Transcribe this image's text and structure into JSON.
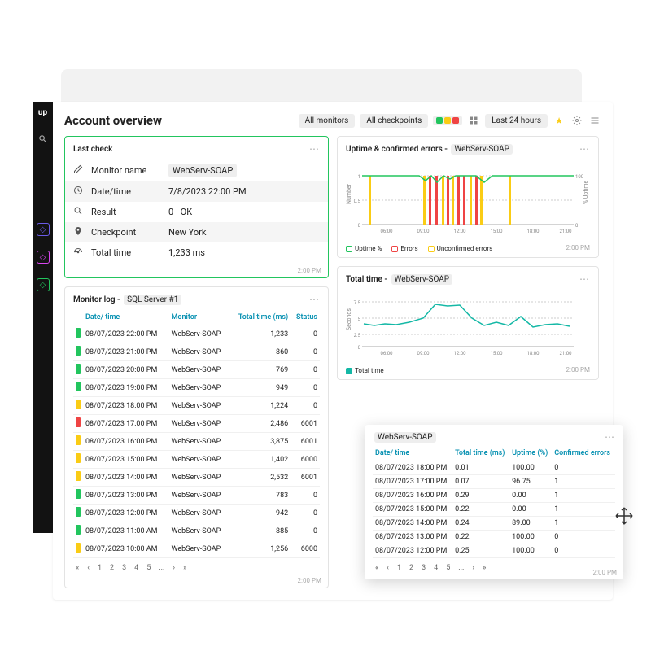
{
  "header": {
    "title": "Account overview",
    "all_monitors": "All monitors",
    "all_checkpoints": "All checkpoints",
    "time_range": "Last 24 hours"
  },
  "last_check": {
    "title": "Last check",
    "rows": [
      {
        "icon": "pencil",
        "label": "Monitor name",
        "value": "WebServ-SOAP",
        "boxed": true
      },
      {
        "icon": "clock",
        "label": "Date/time",
        "value": "7/8/2023 22:00 PM",
        "alt": true
      },
      {
        "icon": "search",
        "label": "Result",
        "value": "0 - OK"
      },
      {
        "icon": "pin",
        "label": "Checkpoint",
        "value": "New York",
        "alt": true
      },
      {
        "icon": "gauge",
        "label": "Total time",
        "value": "1,233 ms"
      }
    ],
    "ts": "2:00 PM"
  },
  "monitor_log": {
    "title": "Monitor log -",
    "chip": "SQL Server #1",
    "headers": [
      "Date/ time",
      "Monitor",
      "Total time (ms)",
      "Status"
    ],
    "rows": [
      {
        "s": "g",
        "dt": "08/07/2023 22:00 PM",
        "m": "WebServ-SOAP",
        "t": "1,233",
        "st": "0"
      },
      {
        "s": "g",
        "dt": "08/07/2023 21:00 PM",
        "m": "WebServ-SOAP",
        "t": "860",
        "st": "0"
      },
      {
        "s": "g",
        "dt": "08/07/2023 20:00 PM",
        "m": "WebServ-SOAP",
        "t": "769",
        "st": "0"
      },
      {
        "s": "g",
        "dt": "08/07/2023 19:00 PM",
        "m": "WebServ-SOAP",
        "t": "949",
        "st": "0"
      },
      {
        "s": "y",
        "dt": "08/07/2023 18:00 PM",
        "m": "WebServ-SOAP",
        "t": "1,224",
        "st": "0"
      },
      {
        "s": "r",
        "dt": "08/07/2023 17:00 PM",
        "m": "WebServ-SOAP",
        "t": "2,486",
        "st": "6001"
      },
      {
        "s": "y",
        "dt": "08/07/2023 16:00 PM",
        "m": "WebServ-SOAP",
        "t": "3,875",
        "st": "6001"
      },
      {
        "s": "y",
        "dt": "08/07/2023 15:00 PM",
        "m": "WebServ-SOAP",
        "t": "1,402",
        "st": "6000"
      },
      {
        "s": "y",
        "dt": "08/07/2023 14:00 PM",
        "m": "WebServ-SOAP",
        "t": "2,532",
        "st": "6001"
      },
      {
        "s": "g",
        "dt": "08/07/2023 13:00 PM",
        "m": "WebServ-SOAP",
        "t": "783",
        "st": "0"
      },
      {
        "s": "g",
        "dt": "08/07/2023 12:00 PM",
        "m": "WebServ-SOAP",
        "t": "942",
        "st": "0"
      },
      {
        "s": "g",
        "dt": "08/07/2023 11:00 AM",
        "m": "WebServ-SOAP",
        "t": "885",
        "st": "0"
      },
      {
        "s": "y",
        "dt": "08/07/2023 10:00 AM",
        "m": "WebServ-SOAP",
        "t": "1,256",
        "st": "6000"
      }
    ],
    "pages": [
      "1",
      "2",
      "3",
      "4",
      "5",
      "..."
    ],
    "ts": "2:00 PM"
  },
  "uptime_chart": {
    "title": "Uptime & confirmed errors -",
    "chip": "WebServ-SOAP",
    "ylabel_left": "Number",
    "ylabel_right": "% Uptime",
    "legend": [
      "Uptime %",
      "Errors",
      "Unconfirmed errors"
    ],
    "ts": "2:00 PM"
  },
  "totaltime_chart": {
    "title": "Total time -",
    "chip": "WebServ-SOAP",
    "ylabel": "Seconds",
    "legend": [
      "Total time"
    ],
    "ts": "2:00 PM"
  },
  "chart_data": [
    {
      "type": "line",
      "title": "Uptime & confirmed errors - WebServ-SOAP",
      "x_ticks": [
        "06:00",
        "09:00",
        "12:00",
        "15:00",
        "18:00",
        "21:00"
      ],
      "ylim_left": [
        0,
        1.5
      ],
      "ytick_left": [
        0,
        0.5,
        1
      ],
      "ylim_right": [
        0,
        100
      ],
      "ytick_right": [
        0,
        100
      ],
      "series": [
        {
          "name": "Uptime %",
          "color": "#22c55e",
          "axis": "right",
          "x": [
            "06:00",
            "09:00",
            "10:00",
            "10:30",
            "10:45",
            "11:00",
            "11:30",
            "12:00",
            "12:30",
            "13:00",
            "13:30",
            "14:00",
            "15:00",
            "18:00",
            "21:00"
          ],
          "values": [
            100,
            100,
            96,
            100,
            89,
            100,
            96,
            100,
            100,
            100,
            100,
            89,
            100,
            100,
            100
          ]
        },
        {
          "name": "Errors",
          "color": "#ef4444",
          "axis": "left",
          "type": "bar",
          "x": [
            "10:15",
            "10:45",
            "11:00",
            "11:30",
            "11:45",
            "12:15",
            "12:30",
            "12:45"
          ],
          "values": [
            1,
            1,
            1,
            1,
            1,
            1,
            1,
            1
          ]
        },
        {
          "name": "Unconfirmed errors",
          "color": "#facc15",
          "axis": "left",
          "type": "bar",
          "x": [
            "06:00",
            "10:00",
            "11:15",
            "12:00",
            "13:00",
            "13:45",
            "16:30"
          ],
          "values": [
            1,
            1,
            1,
            1,
            1,
            1,
            1
          ]
        }
      ]
    },
    {
      "type": "line",
      "title": "Total time - WebServ-SOAP",
      "x_ticks": [
        "06:00",
        "09:00",
        "12:00",
        "15:00",
        "18:00",
        "21:00"
      ],
      "ylim": [
        0,
        8
      ],
      "ytick": [
        0,
        2.5,
        5,
        7.5
      ],
      "series": [
        {
          "name": "Total time",
          "color": "#14b8a6",
          "x": [
            "05:00",
            "06:00",
            "07:00",
            "08:00",
            "09:00",
            "10:00",
            "11:00",
            "12:00",
            "13:00",
            "14:00",
            "15:00",
            "16:00",
            "17:00",
            "18:00",
            "19:00",
            "20:00",
            "21:00",
            "22:00"
          ],
          "values": [
            4.2,
            4.0,
            4.3,
            4.1,
            4.5,
            5.0,
            7.2,
            6.8,
            7.0,
            5.0,
            4.0,
            4.5,
            4.0,
            5.2,
            3.8,
            4.1,
            4.2,
            3.9
          ]
        }
      ]
    }
  ],
  "popup": {
    "chip": "WebServ-SOAP",
    "headers": [
      "Date/ time",
      "Total time (ms)",
      "Uptime (%)",
      "Confirmed errors"
    ],
    "rows": [
      {
        "dt": "08/07/2023 18:00 PM",
        "t": "0.01",
        "u": "100.00",
        "e": "0"
      },
      {
        "dt": "08/07/2023 17:00 PM",
        "t": "0.07",
        "u": "96.75",
        "e": "1"
      },
      {
        "dt": "08/07/2023 16:00 PM",
        "t": "0.29",
        "u": "0.00",
        "e": "1"
      },
      {
        "dt": "08/07/2023 15:00 PM",
        "t": "0.22",
        "u": "0.00",
        "e": "1"
      },
      {
        "dt": "08/07/2023 14:00 PM",
        "t": "0.24",
        "u": "89.00",
        "e": "1"
      },
      {
        "dt": "08/07/2023 13:00 PM",
        "t": "0.22",
        "u": "100.00",
        "e": "0"
      },
      {
        "dt": "08/07/2023 12:00 PM",
        "t": "0.25",
        "u": "100.00",
        "e": "0"
      }
    ],
    "pages": [
      "1",
      "2",
      "3",
      "4",
      "5",
      "..."
    ],
    "ts": "2:00 PM"
  }
}
